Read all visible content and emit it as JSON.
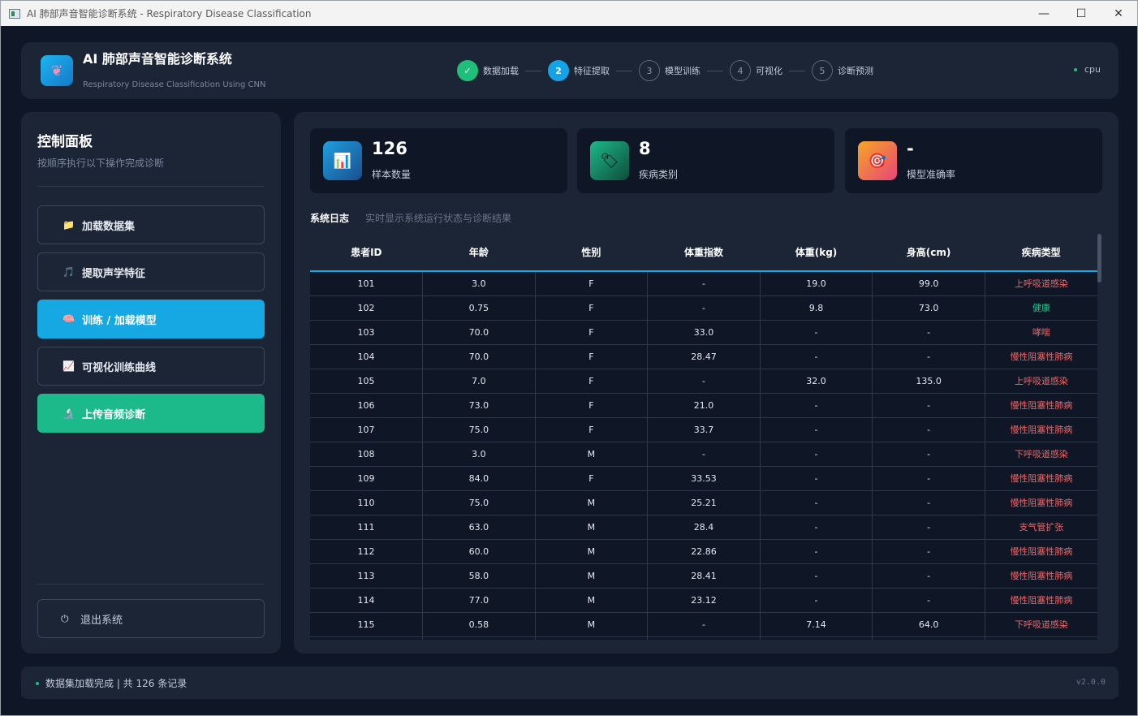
{
  "window": {
    "title": "AI 肺部声音智能诊断系统 - Respiratory Disease Classification",
    "controls": [
      "—",
      "☐",
      "✕"
    ]
  },
  "header": {
    "title": "AI 肺部声音智能诊断系统",
    "subtitle": "Respiratory Disease Classification Using CNN",
    "steps": [
      {
        "num": "✓",
        "label": "数据加载",
        "state": "done"
      },
      {
        "num": "2",
        "label": "特征提取",
        "state": "active"
      },
      {
        "num": "3",
        "label": "模型训练",
        "state": "pending"
      },
      {
        "num": "4",
        "label": "可视化",
        "state": "pending"
      },
      {
        "num": "5",
        "label": "诊断预测",
        "state": "pending"
      }
    ],
    "device": "cpu"
  },
  "control": {
    "title": "控制面板",
    "subtitle": "按顺序执行以下操作完成诊断",
    "buttons": [
      {
        "icon": "📁",
        "label": "加载数据集"
      },
      {
        "icon": "🎵",
        "label": "提取声学特征"
      },
      {
        "icon": "🧠",
        "label": "训练 / 加载模型"
      },
      {
        "icon": "📈",
        "label": "可视化训练曲线"
      },
      {
        "icon": "🔬",
        "label": "上传音频诊断"
      }
    ],
    "exit": {
      "icon": "⏻",
      "label": "退出系统"
    }
  },
  "stats": [
    {
      "icon": "📊",
      "value": "126",
      "label": "样本数量"
    },
    {
      "icon": "🏷",
      "value": "8",
      "label": "疾病类别"
    },
    {
      "icon": "🎯",
      "value": "-",
      "label": "模型准确率"
    }
  ],
  "log": {
    "title": "系统日志",
    "subtitle": "实时显示系统运行状态与诊断结果"
  },
  "table": {
    "columns": [
      "患者ID",
      "年龄",
      "性别",
      "体重指数",
      "体重(kg)",
      "身高(cm)",
      "疾病类型"
    ],
    "rows": [
      [
        "101",
        "3.0",
        "F",
        "-",
        "19.0",
        "99.0",
        "上呼吸道感染"
      ],
      [
        "102",
        "0.75",
        "F",
        "-",
        "9.8",
        "73.0",
        "健康"
      ],
      [
        "103",
        "70.0",
        "F",
        "33.0",
        "-",
        "-",
        "哮喘"
      ],
      [
        "104",
        "70.0",
        "F",
        "28.47",
        "-",
        "-",
        "慢性阻塞性肺病"
      ],
      [
        "105",
        "7.0",
        "F",
        "-",
        "32.0",
        "135.0",
        "上呼吸道感染"
      ],
      [
        "106",
        "73.0",
        "F",
        "21.0",
        "-",
        "-",
        "慢性阻塞性肺病"
      ],
      [
        "107",
        "75.0",
        "F",
        "33.7",
        "-",
        "-",
        "慢性阻塞性肺病"
      ],
      [
        "108",
        "3.0",
        "M",
        "-",
        "-",
        "-",
        "下呼吸道感染"
      ],
      [
        "109",
        "84.0",
        "F",
        "33.53",
        "-",
        "-",
        "慢性阻塞性肺病"
      ],
      [
        "110",
        "75.0",
        "M",
        "25.21",
        "-",
        "-",
        "慢性阻塞性肺病"
      ],
      [
        "111",
        "63.0",
        "M",
        "28.4",
        "-",
        "-",
        "支气管扩张"
      ],
      [
        "112",
        "60.0",
        "M",
        "22.86",
        "-",
        "-",
        "慢性阻塞性肺病"
      ],
      [
        "113",
        "58.0",
        "M",
        "28.41",
        "-",
        "-",
        "慢性阻塞性肺病"
      ],
      [
        "114",
        "77.0",
        "M",
        "23.12",
        "-",
        "-",
        "慢性阻塞性肺病"
      ],
      [
        "115",
        "0.58",
        "M",
        "-",
        "7.14",
        "64.0",
        "下呼吸道感染"
      ],
      [
        "116",
        "",
        "",
        "",
        "",
        "",
        ""
      ]
    ]
  },
  "footer": {
    "status": "数据集加载完成 | 共 126 条记录",
    "version": "v2.0.0"
  }
}
